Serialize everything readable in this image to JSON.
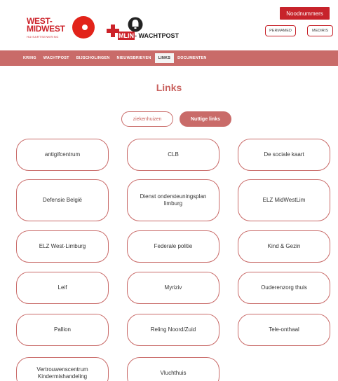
{
  "header": {
    "logo1": {
      "line1": "WEST-",
      "line2": "MIDWEST",
      "sub": "HUISARTSENKRING"
    },
    "logo2": {
      "text_a": "MLIN",
      "text_b": "- WACHTPOST"
    },
    "noodnummers_label": "Noodnummers",
    "permamed_label": "PERMAMED",
    "mediris_label": "MEDIRIS",
    "brand_color": "#c7232b"
  },
  "nav": {
    "items": [
      {
        "label": "KRING"
      },
      {
        "label": "WACHTPOST"
      },
      {
        "label": "BIJSCHOLINGEN"
      },
      {
        "label": "NIEUWSBRIEVEN"
      },
      {
        "label": "LINKS",
        "active": true
      },
      {
        "label": "DOCUMENTEN"
      }
    ],
    "bar_color": "#c96b69"
  },
  "page_title": "Links",
  "toggles": {
    "ziekenhuizen": "ziekenhuizen",
    "nuttige_links": "Nuttige links"
  },
  "cards": [
    "antigifcentrum",
    "CLB",
    "De sociale kaart",
    "Defensie België",
    "Dienst ondersteuningsplan limburg",
    "ELZ MidWestLim",
    "ELZ West-Limburg",
    "Federale politie",
    "Kind & Gezin",
    "Leif",
    "Myriziv",
    "Ouderenzorg thuis",
    "Pallion",
    "Reling Noord/Zuid",
    "Tele-onthaal",
    "Vertrouwenscentrum Kindermishandeling",
    "Vluchthuis"
  ]
}
